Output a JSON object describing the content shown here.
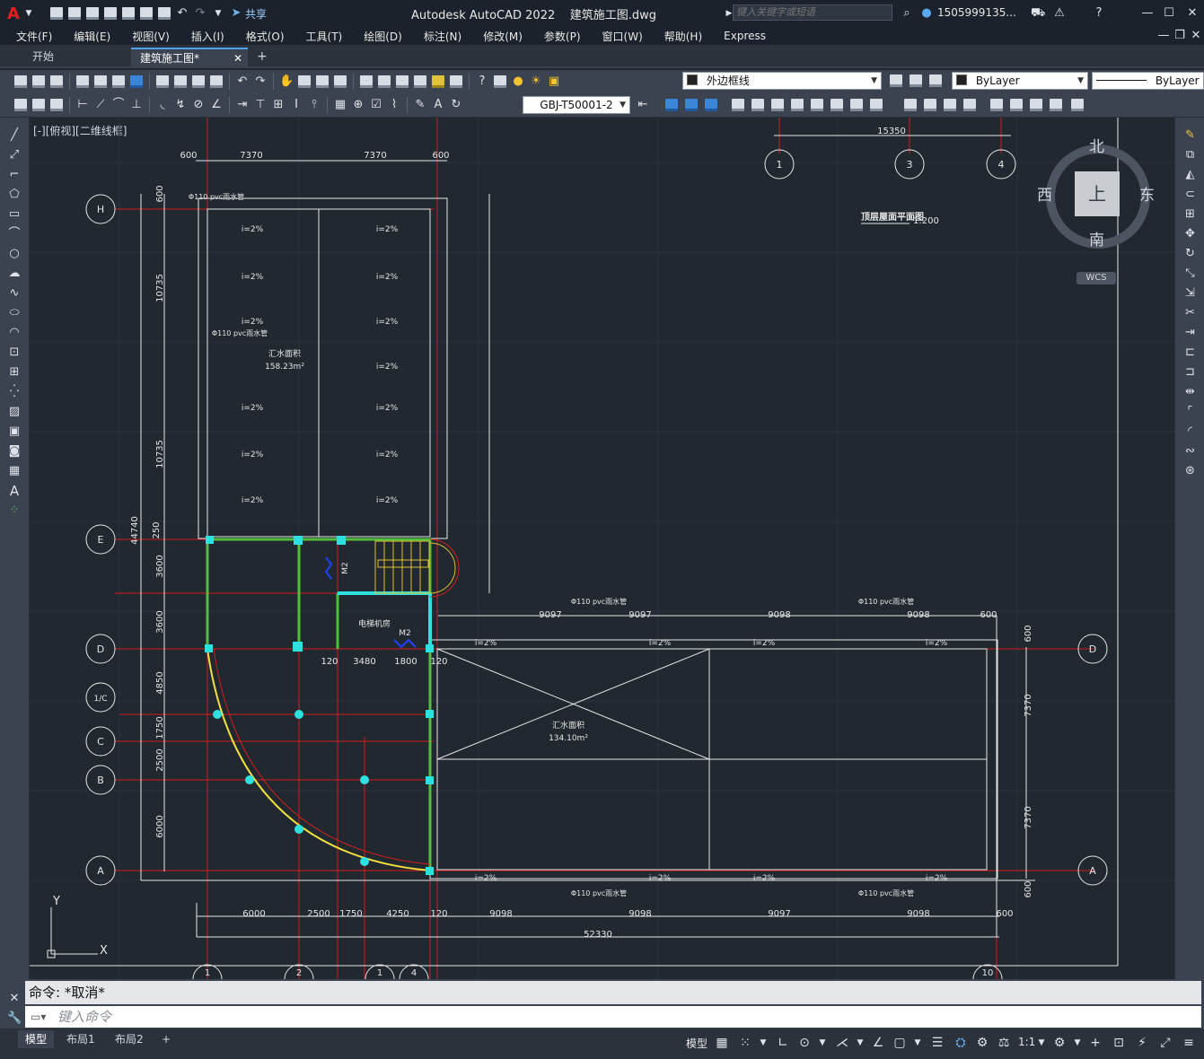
{
  "titlebar": {
    "app_logo": "A",
    "share_label": "共享",
    "title": "Autodesk AutoCAD 2022    建筑施工图.dwg",
    "search_placeholder": "键入关键字或短语",
    "username": "1505999135..."
  },
  "menubar": {
    "items": [
      "文件(F)",
      "编辑(E)",
      "视图(V)",
      "插入(I)",
      "格式(O)",
      "工具(T)",
      "绘图(D)",
      "标注(N)",
      "修改(M)",
      "参数(P)",
      "窗口(W)",
      "帮助(H)",
      "Express"
    ]
  },
  "tabs": {
    "start": "开始",
    "active": "建筑施工图*"
  },
  "ribbon": {
    "layer_value": "外边框线",
    "color_value": "ByLayer",
    "linetype_value": "ByLayer",
    "dimstyle_value": "GBJ-T50001-2"
  },
  "canvas": {
    "view_label": "[-][俯视][二维线框]",
    "viewcube": {
      "north": "北",
      "south": "南",
      "east": "东",
      "west": "西",
      "face": "上",
      "wcs": "WCS"
    },
    "drawing_title": "顶层屋面平面图",
    "drawing_scale": "1:200",
    "area_left_label": "汇水面积",
    "area_left_value": "158.23m²",
    "area_right_label": "汇水面积",
    "area_right_value": "134.10m²",
    "slope_label": "i=2%",
    "pipe_label": "Φ110 pvc雨水管",
    "room_label": "电梯机房",
    "door_label": "M2",
    "ucs_x": "X",
    "ucs_y": "Y",
    "grid_top": [
      "1",
      "3",
      "4"
    ],
    "grid_left": [
      "H",
      "E",
      "D",
      "1/C",
      "C",
      "B",
      "A"
    ],
    "grid_right": [
      "D",
      "A"
    ],
    "top_dims": [
      "600",
      "7370",
      "7370",
      "600"
    ],
    "top_right_dim": "15350",
    "left_dims": [
      "600",
      "10735",
      "10735",
      "250",
      "3600",
      "3600",
      "4850",
      "1750",
      "2500",
      "6000"
    ],
    "left_total": "44740",
    "mid_dims": [
      "9097",
      "9097",
      "9098",
      "9098",
      "600"
    ],
    "small_dims": [
      "120",
      "3480",
      "1800",
      "120"
    ],
    "bottom_dims": [
      "6000",
      "2500",
      "1750",
      "4250",
      "120",
      "9098",
      "9098",
      "9097",
      "9098",
      "600"
    ],
    "bottom_total": "52330",
    "right_dims": [
      "600",
      "7370",
      "7370",
      "600"
    ],
    "bottom_grid": [
      "1",
      "2",
      "1",
      "4",
      "10"
    ]
  },
  "command": {
    "history": "命令: *取消*",
    "placeholder": "键入命令"
  },
  "layouts": {
    "model": "模型",
    "layout1": "布局1",
    "layout2": "布局2"
  },
  "status": {
    "model_label": "模型",
    "scale": "1:1"
  }
}
